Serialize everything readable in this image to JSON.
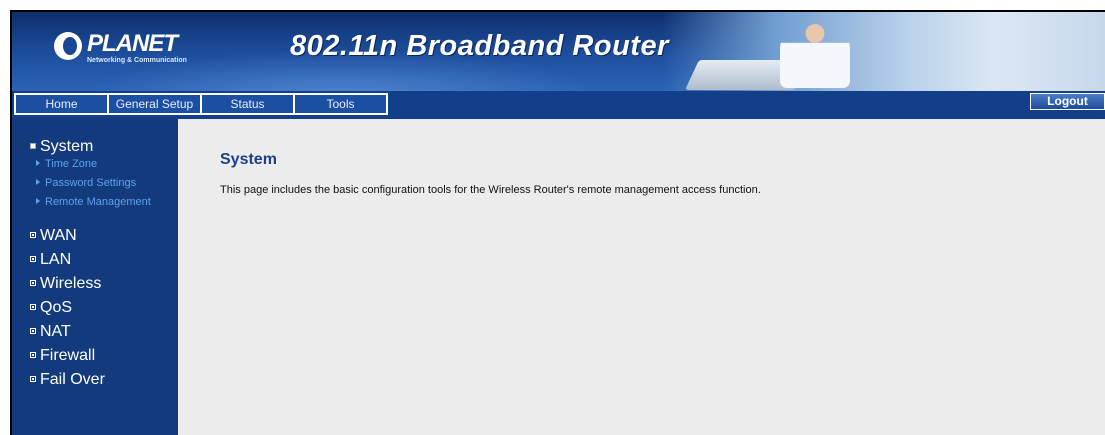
{
  "header": {
    "logo_name": "PLANET",
    "logo_tagline": "Networking & Communication",
    "product_title": "802.11n Broadband Router"
  },
  "nav": {
    "tabs": [
      {
        "label": "Home"
      },
      {
        "label": "General Setup"
      },
      {
        "label": "Status"
      },
      {
        "label": "Tools"
      }
    ],
    "logout_label": "Logout"
  },
  "sidebar": {
    "system": {
      "label": "System",
      "sub_items": [
        {
          "label": "Time Zone"
        },
        {
          "label": "Password Settings"
        },
        {
          "label": "Remote Management"
        }
      ]
    },
    "items": [
      {
        "label": "WAN"
      },
      {
        "label": "LAN"
      },
      {
        "label": "Wireless"
      },
      {
        "label": "QoS"
      },
      {
        "label": "NAT"
      },
      {
        "label": "Firewall"
      },
      {
        "label": "Fail Over"
      }
    ]
  },
  "main": {
    "title": "System",
    "description": "This page includes the basic configuration tools for the Wireless Router's remote management access function."
  },
  "colors": {
    "banner_dark": "#0f2f6d",
    "nav_bar": "#133f8a",
    "sidebar_bg": "#123a7d",
    "submenu_link": "#5fa2ee",
    "title_blue": "#1a3f8c",
    "content_bg": "#ececec"
  }
}
